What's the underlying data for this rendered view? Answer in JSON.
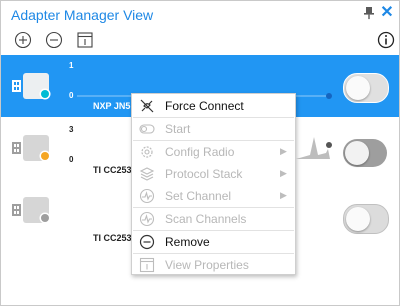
{
  "window": {
    "title": "Adapter Manager View"
  },
  "toolbar": {
    "add": "add-icon",
    "remove": "remove-icon",
    "properties": "properties-icon",
    "info": "info-icon"
  },
  "devices": [
    {
      "count_top": "1",
      "count_bottom": "0",
      "name": "NXP JN5",
      "status_color": "#00bcd4",
      "selected": true
    },
    {
      "count_top": "3",
      "count_bottom": "0",
      "name": "TI CC253",
      "status_color": "#f5a623",
      "selected": false
    },
    {
      "count_top": "",
      "count_bottom": "",
      "name": "TI CC253",
      "status_color": "#9e9e9e",
      "selected": false
    }
  ],
  "context_menu": {
    "items": [
      {
        "label": "Force Connect",
        "enabled": true,
        "icon": "disconnected-plug-icon",
        "submenu": false
      },
      {
        "label": "Start",
        "enabled": false,
        "icon": "toggle-start-icon",
        "submenu": false
      },
      {
        "label": "Config Radio",
        "enabled": false,
        "icon": "gear-icon",
        "submenu": true
      },
      {
        "label": "Protocol Stack",
        "enabled": false,
        "icon": "stack-layers-icon",
        "submenu": true
      },
      {
        "label": "Set Channel",
        "enabled": false,
        "icon": "channel-icon",
        "submenu": true
      },
      {
        "label": "Scan Channels",
        "enabled": false,
        "icon": "scan-icon",
        "submenu": false
      },
      {
        "label": "Remove",
        "enabled": true,
        "icon": "minus-circle-icon",
        "submenu": false
      },
      {
        "label": "View Properties",
        "enabled": false,
        "icon": "properties-icon",
        "submenu": false
      }
    ]
  },
  "colors": {
    "accent": "#1e88e5",
    "selection": "#2196f3"
  }
}
